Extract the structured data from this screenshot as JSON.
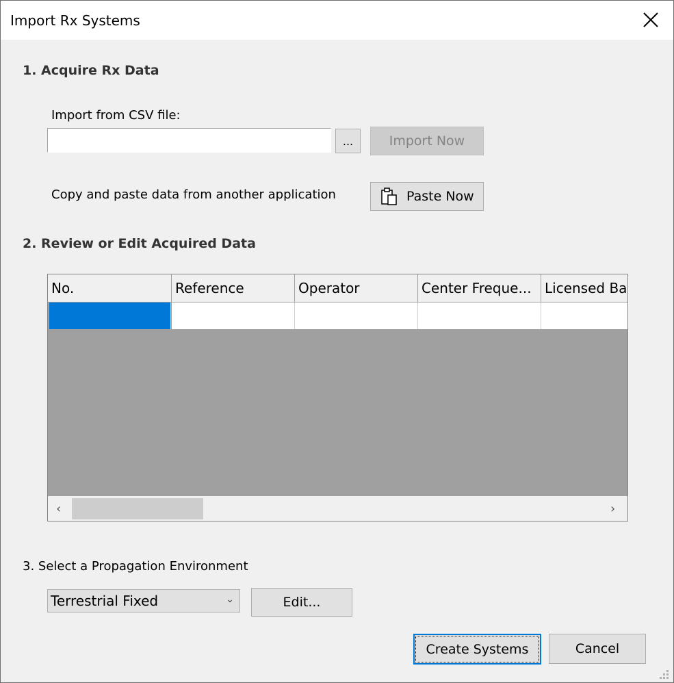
{
  "window": {
    "title": "Import Rx Systems",
    "close_icon": "close-icon"
  },
  "section1": {
    "heading": "1. Acquire Rx Data",
    "csv_label": "Import from CSV file:",
    "csv_path_value": "",
    "browse_label": "...",
    "import_now_label": "Import Now",
    "paste_label": "Copy and paste data from another application",
    "paste_now_label": "Paste Now",
    "paste_icon": "clipboard-paste-icon"
  },
  "section2": {
    "heading": "2. Review or Edit Acquired Data",
    "columns": [
      "No.",
      "Reference",
      "Operator",
      "Center Freque...",
      "Licensed Ba"
    ],
    "rows": [
      [
        "",
        "",
        "",
        "",
        ""
      ]
    ],
    "scroll_left": "‹",
    "scroll_right": "›"
  },
  "section3": {
    "heading": "3. Select a Propagation Environment",
    "environment_selected": "Terrestrial Fixed",
    "edit_label": "Edit..."
  },
  "footer": {
    "create_label": "Create Systems",
    "cancel_label": "Cancel"
  },
  "colors": {
    "selection": "#0078d7",
    "grid_background": "#a0a0a0",
    "dialog_background": "#f0f0f0"
  }
}
